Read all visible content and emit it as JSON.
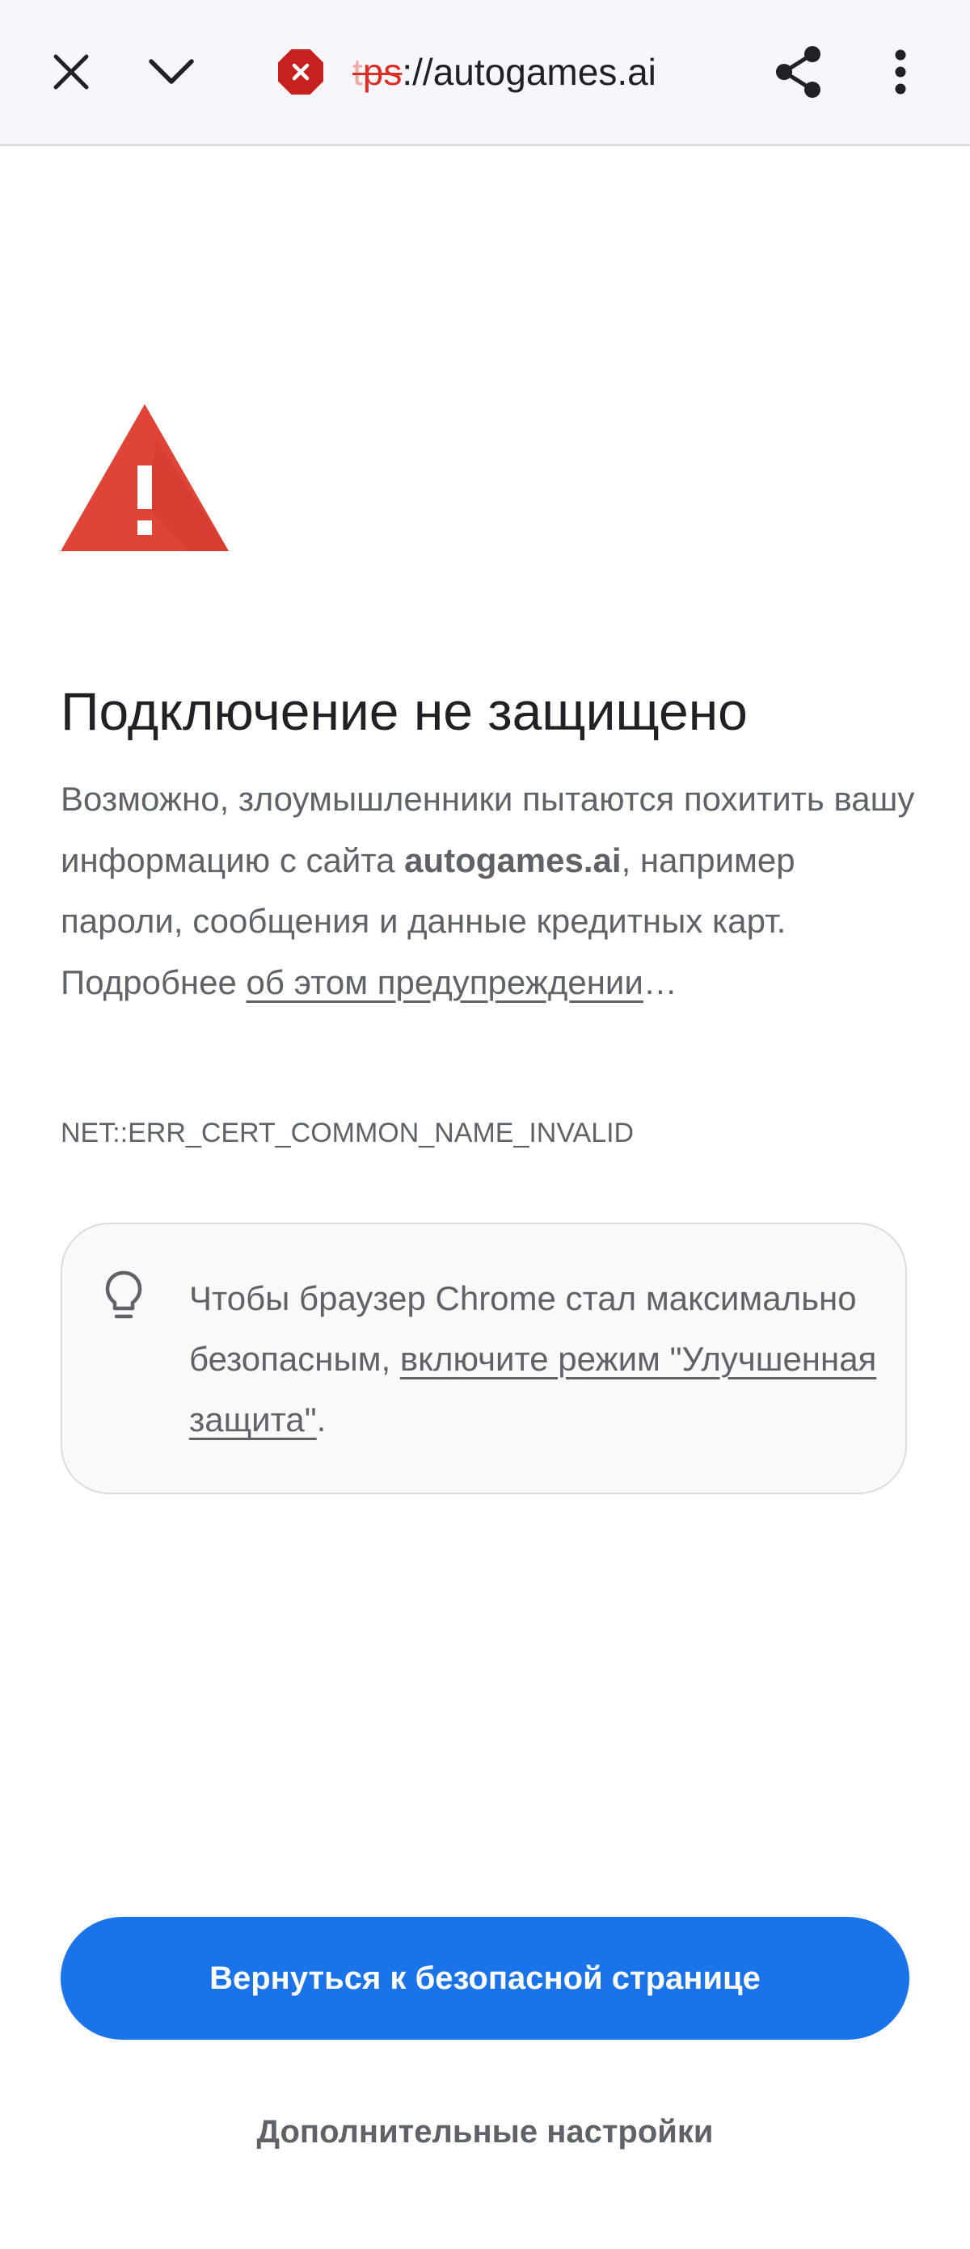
{
  "toolbar": {
    "close_icon": "close-icon",
    "chevron_icon": "chevron-down-icon",
    "security_icon": "not-secure-error-icon",
    "url_scheme_faded": "t",
    "url_scheme": "ps",
    "url_rest": "://autogames.ai",
    "share_icon": "share-icon",
    "more_icon": "more-vertical-icon"
  },
  "interstitial": {
    "warning_icon": "warning-triangle-icon",
    "heading": "Подключение не защищено",
    "body_part1": "Возможно, злоумышленники пытаются похитить вашу информацию с сайта ",
    "body_site": "autogames.ai",
    "body_part2": ", например пароли, сообщения и данные кредитных карт. Подробнее ",
    "body_link": "об этом предупреждении",
    "body_ellipsis": "…",
    "error_code": "NET::ERR_CERT_COMMON_NAME_INVALID"
  },
  "tip": {
    "icon": "lightbulb-icon",
    "text_before": "Чтобы браузер Chrome стал максимально безопасным, ",
    "link": "включите режим \"Улучшенная защита\"",
    "text_after": "."
  },
  "actions": {
    "primary_label": "Вернуться к безопасной странице",
    "secondary_label": "Дополнительные настройки"
  },
  "colors": {
    "accent": "#1a73e8",
    "error": "#d93025",
    "warning_triangle": "#e04437",
    "toolbar_bg": "#f7f6fb",
    "body_text": "#5f6368"
  }
}
